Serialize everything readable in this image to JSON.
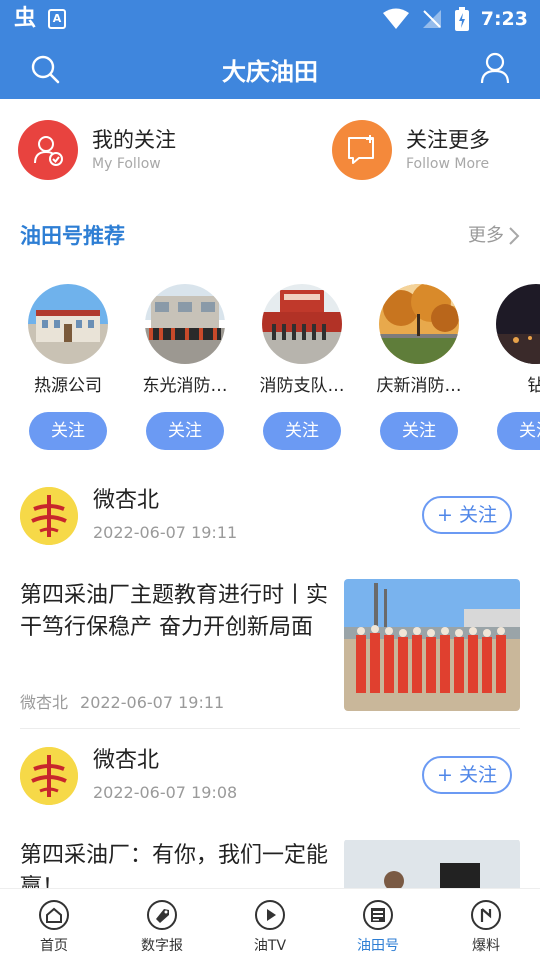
{
  "status_bar": {
    "time": "7:23",
    "app_glyph": "虫"
  },
  "header": {
    "title": "大庆油田"
  },
  "follow_links": [
    {
      "cn": "我的关注",
      "en": "My Follow",
      "color": "#e8433f"
    },
    {
      "cn": "关注更多",
      "en": "Follow  More",
      "color": "#f4893b"
    }
  ],
  "section": {
    "title": "油田号推荐",
    "more": "更多"
  },
  "channels": [
    {
      "name": "热源公司",
      "button": "关注"
    },
    {
      "name": "东光消防…",
      "button": "关注"
    },
    {
      "name": "消防支队…",
      "button": "关注"
    },
    {
      "name": "庆新消防…",
      "button": "关注"
    },
    {
      "name": "钻",
      "button": "关注"
    }
  ],
  "feed": [
    {
      "author": "微杏北",
      "time": "2022-06-07 19:11",
      "follow_label": "+ 关注",
      "article_title": "第四采油厂主题教育进行时丨实干笃行保稳产 奋力开创新局面",
      "meta_source": "微杏北",
      "meta_time": "2022-06-07 19:11"
    },
    {
      "author": "微杏北",
      "time": "2022-06-07 19:08",
      "follow_label": "+ 关注",
      "article_title": "第四采油厂：有你，我们一定能赢！"
    }
  ],
  "bottom_nav": [
    {
      "label": "首页",
      "icon": "home-icon",
      "active": false
    },
    {
      "label": "数字报",
      "icon": "tag-icon",
      "active": false
    },
    {
      "label": "油TV",
      "icon": "play-icon",
      "active": false
    },
    {
      "label": "油田号",
      "icon": "newspaper-icon",
      "active": true
    },
    {
      "label": "爆料",
      "icon": "report-icon",
      "active": false
    }
  ],
  "colors": {
    "brand": "#3f86dd",
    "accent": "#2d7ed4",
    "button": "#6b9af3"
  }
}
